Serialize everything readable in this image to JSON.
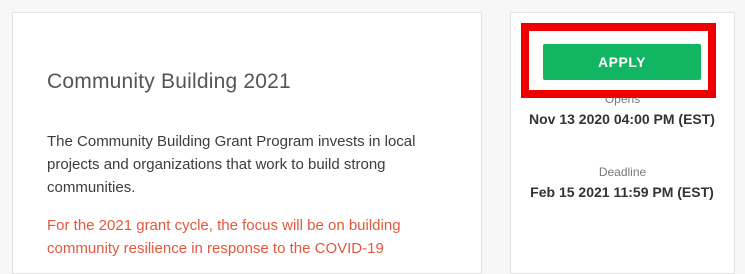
{
  "grant": {
    "title": "Community Building 2021",
    "description": "The Community Building Grant Program invests in local projects and organizations that work to build strong communities.",
    "focus": "For the 2021 grant cycle, the focus will be on building community resilience in response to the COVID-19"
  },
  "sidebar": {
    "apply_label": "APPLY",
    "opens_label": "Opens",
    "opens_value": "Nov 13 2020 04:00 PM (EST)",
    "deadline_label": "Deadline",
    "deadline_value": "Feb 15 2021 11:59 PM (EST)"
  },
  "colors": {
    "apply_button": "#12b561",
    "highlight": "#ee0000",
    "focus_text": "#e4573d"
  }
}
